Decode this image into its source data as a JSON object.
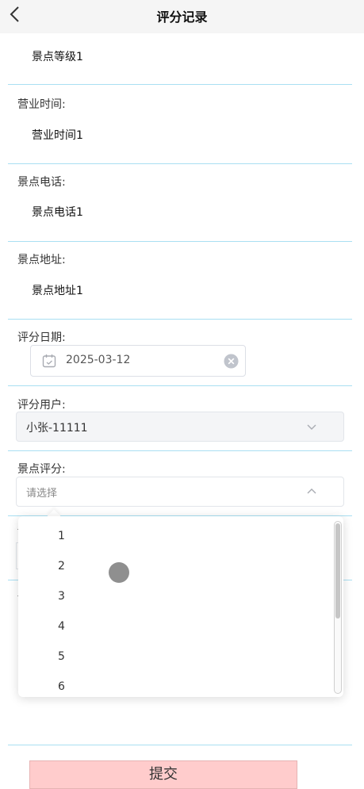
{
  "header": {
    "title": "评分记录"
  },
  "fields": {
    "level_value": "景点等级1",
    "hours_label": "营业时间:",
    "hours_value": "营业时间1",
    "phone_label": "景点电话:",
    "phone_value": "景点电话1",
    "address_label": "景点地址:",
    "address_value": "景点地址1",
    "date_label": "评分日期:",
    "date_value": "2025-03-12",
    "user_label": "评分用户:",
    "user_value": "小张-11111",
    "score_label": "景点评分:",
    "score_placeholder": "请选择"
  },
  "dropdown": {
    "options": [
      "1",
      "2",
      "3",
      "4",
      "5",
      "6"
    ]
  },
  "submit": {
    "label": "提交"
  },
  "icons": {
    "back": "chevron-left-icon",
    "calendar": "calendar-icon",
    "clear": "clear-circle-icon",
    "user_chevron": "chevron-down-icon",
    "score_chevron": "chevron-up-icon"
  },
  "colors": {
    "separator": "#a9dff2",
    "submit_bg": "#ffcccc"
  }
}
